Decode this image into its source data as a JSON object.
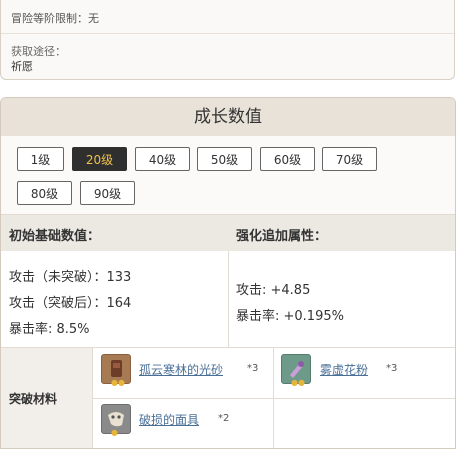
{
  "info": {
    "level_limit": "冒险等阶限制：无",
    "obtain_label": "获取途径：",
    "obtain_value": "祈愿"
  },
  "growth": {
    "title": "成长数值",
    "levels": [
      "1级",
      "20级",
      "40级",
      "50级",
      "60级",
      "70级",
      "80级",
      "90级"
    ],
    "selected_level": "20级",
    "base_header": "初始基础数值：",
    "refine_header": "强化追加属性：",
    "base_stats": [
      "攻击（未突破）：133",
      "攻击（突破后）：164",
      "暴击率: 8.5%"
    ],
    "refine_stats": [
      "攻击: +4.85",
      "暴击率: +0.195%"
    ],
    "materials_label": "突破材料",
    "materials": [
      {
        "name": "孤云寒林的光砂",
        "count": "*3",
        "icon": "brown-sand-icon"
      },
      {
        "name": "雾虚花粉",
        "count": "*3",
        "icon": "purple-pollen-icon"
      },
      {
        "name": "破损的面具",
        "count": "*2",
        "icon": "broken-mask-icon"
      }
    ]
  }
}
